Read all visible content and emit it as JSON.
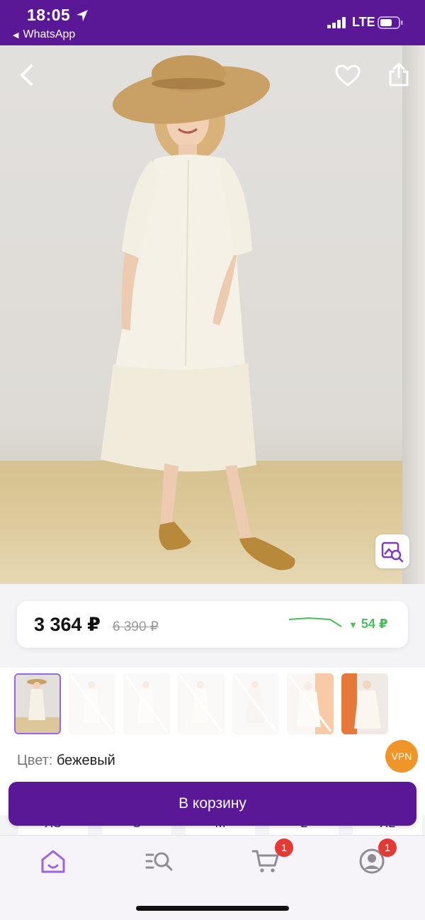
{
  "status_bar": {
    "time": "18:05",
    "back_app": "WhatsApp",
    "network": "LTE"
  },
  "hero": {
    "icons": [
      "back-icon",
      "heart-icon",
      "share-icon",
      "visual-search-icon"
    ]
  },
  "price": {
    "current": "3 364 ₽",
    "old": "6 390 ₽",
    "drop": "54 ₽",
    "drop_color": "#4cbb5a"
  },
  "thumbnails": [
    {
      "selected": true,
      "available": true
    },
    {
      "selected": false,
      "available": false
    },
    {
      "selected": false,
      "available": false
    },
    {
      "selected": false,
      "available": false
    },
    {
      "selected": false,
      "available": false
    },
    {
      "selected": false,
      "available": false
    },
    {
      "selected": false,
      "available": true
    }
  ],
  "color": {
    "label": "Цвет:",
    "value": "бежевый"
  },
  "vpn_badge": "VPN",
  "sizes": [
    "XS",
    "S",
    "M",
    "L",
    "XL"
  ],
  "cart_button": "В корзину",
  "tabbar": {
    "items": [
      {
        "name": "home",
        "icon": "home-icon",
        "active": true
      },
      {
        "name": "catalog",
        "icon": "search-list-icon",
        "active": false
      },
      {
        "name": "cart",
        "icon": "cart-icon",
        "active": false,
        "badge": "1"
      },
      {
        "name": "profile",
        "icon": "profile-icon",
        "active": false,
        "badge": "1"
      }
    ]
  },
  "colors": {
    "brand": "#5a1896",
    "accent": "#9d63e6",
    "badge": "#e53935",
    "vpn": "#f0952a"
  }
}
